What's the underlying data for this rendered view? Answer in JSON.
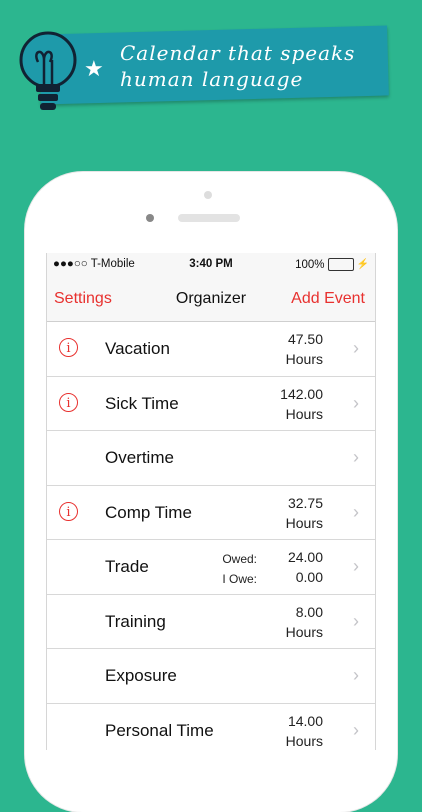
{
  "banner": {
    "text": "Calendar that speaks human language"
  },
  "statusbar": {
    "carrier": "●●●○○ T-Mobile",
    "time": "3:40 PM",
    "battery": "100%",
    "battery_level": 1.0
  },
  "navbar": {
    "left": "Settings",
    "title": "Organizer",
    "right": "Add Event"
  },
  "rows": [
    {
      "label": "Vacation",
      "info": true,
      "value1": "47.50",
      "value2": "Hours"
    },
    {
      "label": "Sick Time",
      "info": true,
      "value1": "142.00",
      "value2": "Hours"
    },
    {
      "label": "Overtime",
      "info": false,
      "value1": "",
      "value2": ""
    },
    {
      "label": "Comp Time",
      "info": true,
      "value1": "32.75",
      "value2": "Hours"
    },
    {
      "label": "Trade",
      "info": false,
      "sub1": "Owed:",
      "sub2": "I Owe:",
      "value1": "24.00",
      "value2": "0.00"
    },
    {
      "label": "Training",
      "info": false,
      "value1": "8.00",
      "value2": "Hours"
    },
    {
      "label": "Exposure",
      "info": false,
      "value1": "",
      "value2": ""
    },
    {
      "label": "Personal Time",
      "info": false,
      "value1": "14.00",
      "value2": "Hours"
    }
  ],
  "icons": {
    "info": "i",
    "chevron": "›"
  },
  "colors": {
    "background": "#2cb68f",
    "banner": "#1e9aaa",
    "accent": "#e8312f",
    "battery": "#39c148"
  }
}
